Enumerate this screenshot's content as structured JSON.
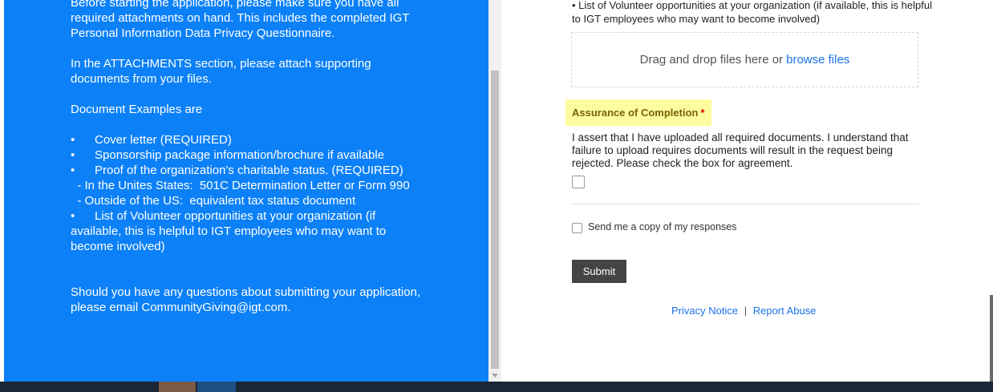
{
  "left_panel": {
    "intro": "Before starting the application, please make sure you have all required attachments on hand.  This includes the completed IGT Personal Information Data Privacy Questionnaire.",
    "attachments_note": "In the ATTACHMENTS section, please attach supporting documents from your files.",
    "examples_heading": "Document Examples are",
    "bullet_char": "•",
    "bullets": [
      "Cover letter (REQUIRED)",
      "Sponsorship package information/brochure if available",
      "Proof of the organization's charitable status. (REQUIRED)"
    ],
    "us_line": "  - In the Unites States:  501C Determination Letter or Form 990",
    "outside_line": "  - Outside of the US:  equivalent tax status document",
    "volunteer_line": "List of Volunteer opportunities at your organization (if available, this is helpful to IGT employees who may want to become involved)",
    "contact": "Should you have any questions about submitting your application, please email CommunityGiving@igt.com."
  },
  "form": {
    "volunteer_text": "•    List of Volunteer opportunities at your organization (if available, this is helpful to IGT employees who may want to become involved)",
    "dropzone_text": "Drag and drop files here or",
    "dropzone_link": "browse files",
    "assurance_label": "Assurance of Completion",
    "required_marker": "*",
    "assert_text": "I assert that I have uploaded all required documents.  I understand that failure to upload requires documents will result in the request being rejected. Please check the box for agreement.",
    "copy_label": "Send me a copy of my responses",
    "submit_label": "Submit",
    "privacy_link": "Privacy Notice",
    "link_separator": "|",
    "report_link": "Report Abuse"
  },
  "colors": {
    "panel_blue": "#0b80f7",
    "link_blue": "#1a73e8",
    "highlight_yellow": "#fdfda0",
    "submit_gray": "#444444"
  }
}
